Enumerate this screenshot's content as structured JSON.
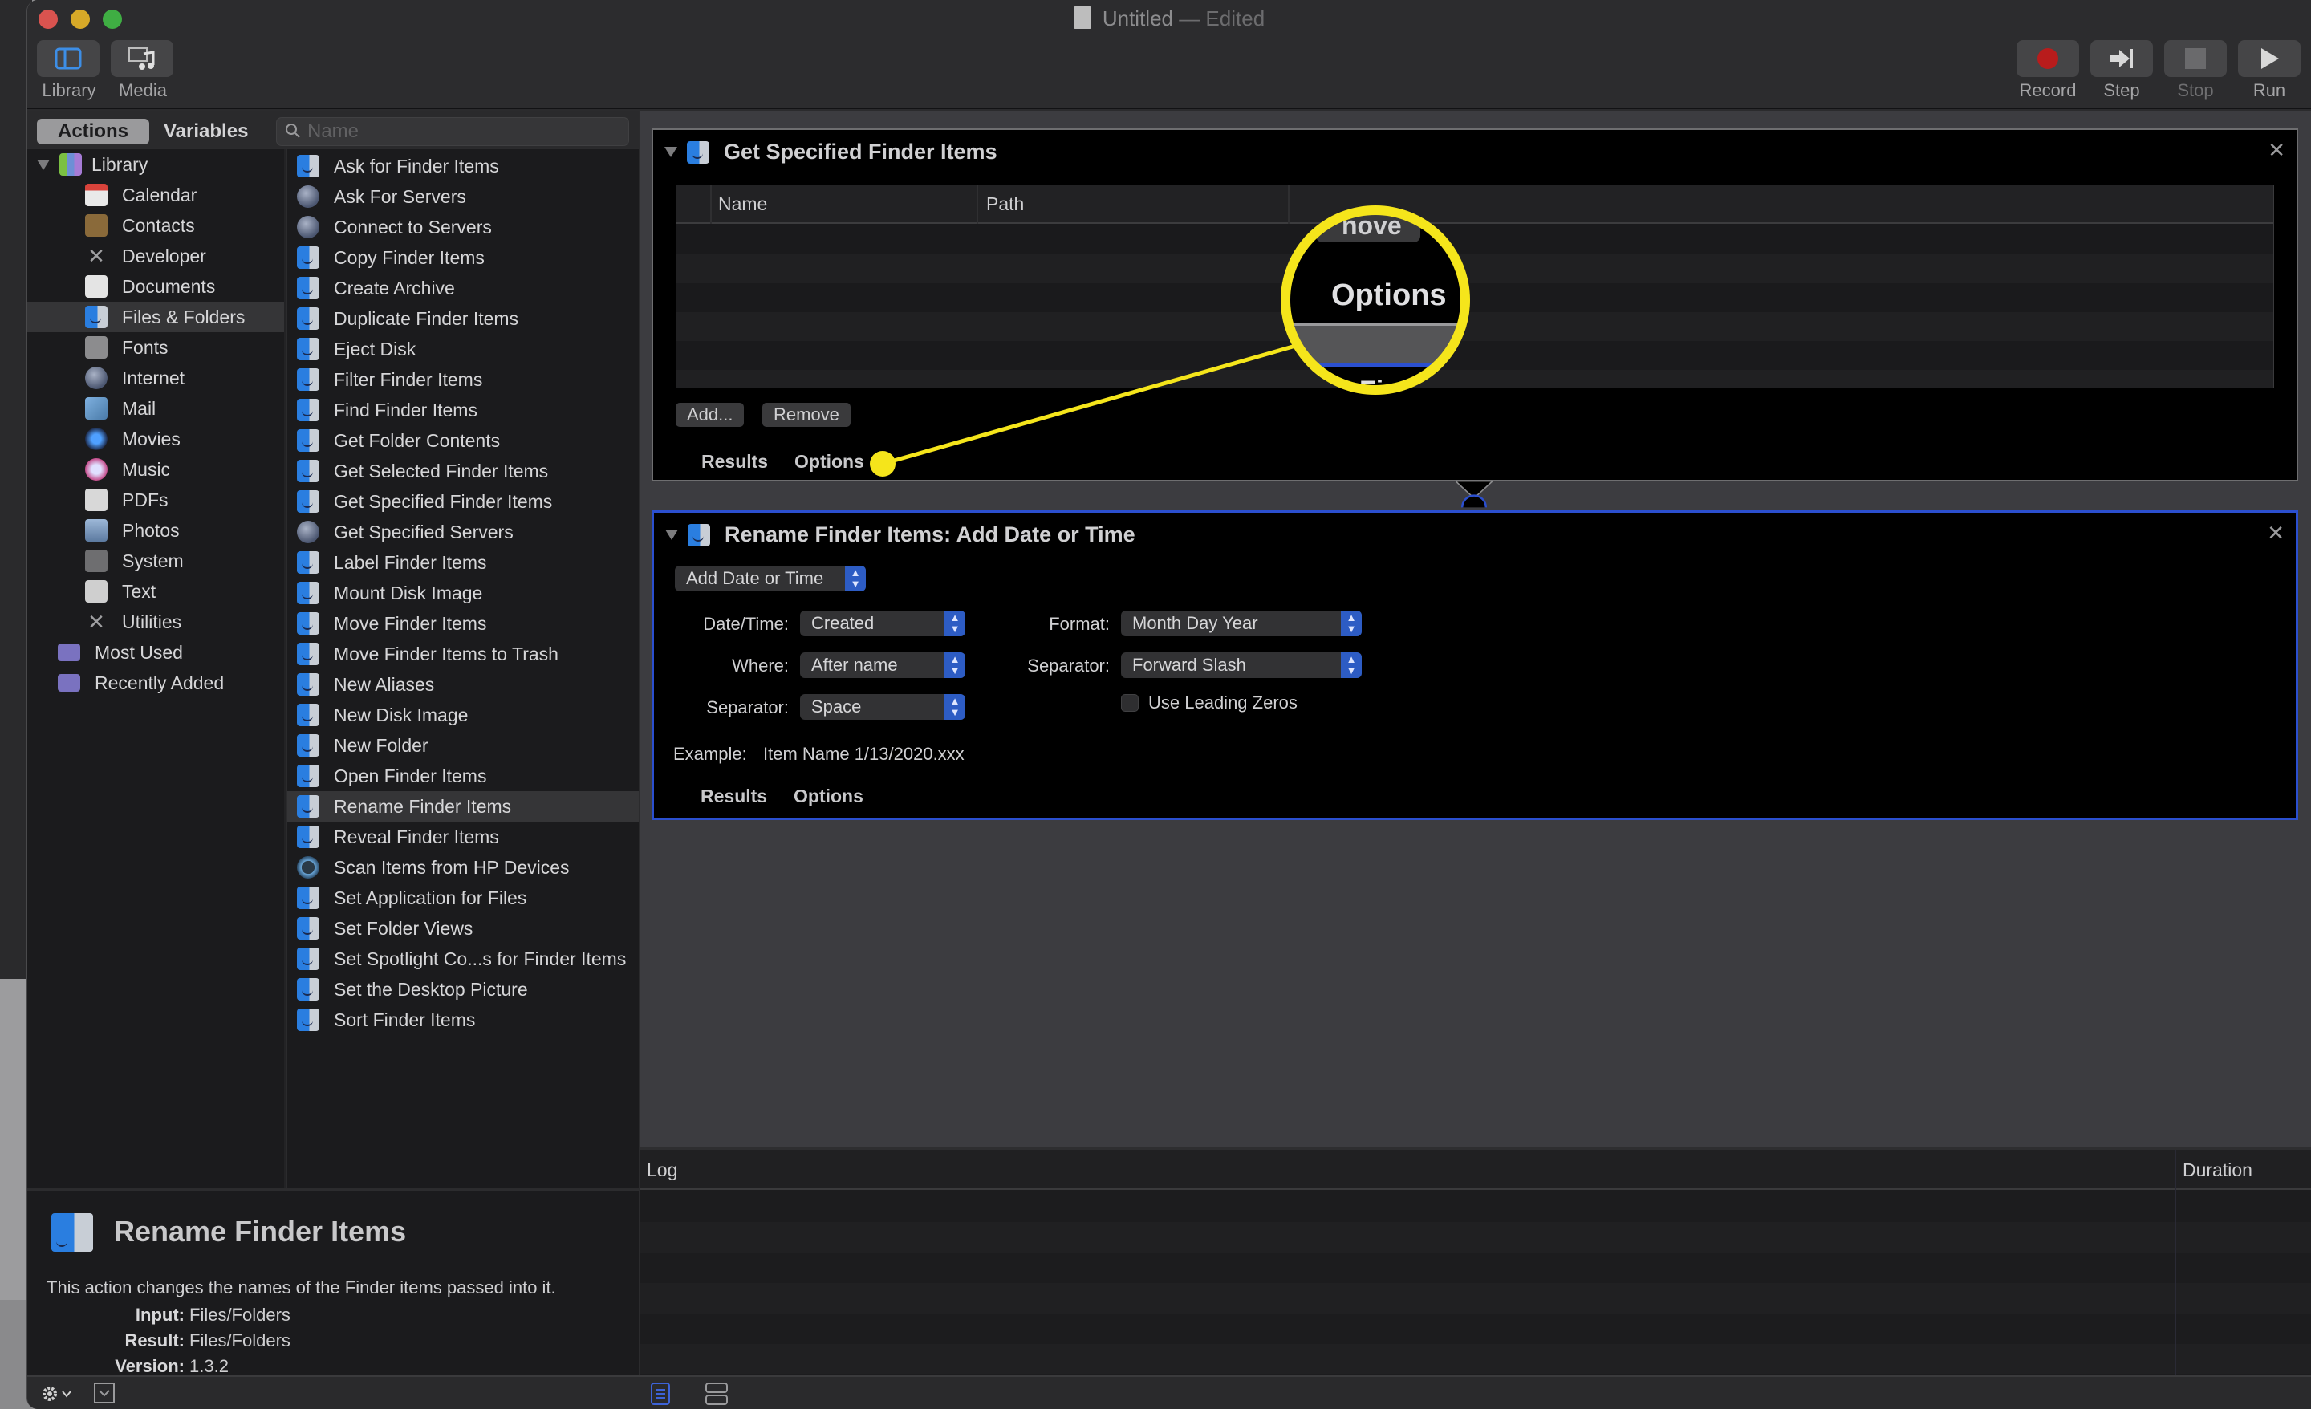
{
  "window": {
    "title": "Untitled",
    "title_suffix": " — Edited"
  },
  "toolbar": {
    "left": [
      {
        "label": "Library",
        "icon": "library-icon"
      },
      {
        "label": "Media",
        "icon": "media-icon"
      }
    ],
    "right": [
      {
        "label": "Record",
        "icon": "record-icon",
        "enabled": true
      },
      {
        "label": "Step",
        "icon": "step-icon",
        "enabled": true
      },
      {
        "label": "Stop",
        "icon": "stop-icon",
        "enabled": false
      },
      {
        "label": "Run",
        "icon": "run-icon",
        "enabled": true
      }
    ]
  },
  "library": {
    "tabs": {
      "actions": "Actions",
      "variables": "Variables"
    },
    "search_placeholder": "Name",
    "root": "Library",
    "categories": [
      {
        "label": "Calendar",
        "icon": "calendar-icon"
      },
      {
        "label": "Contacts",
        "icon": "contacts-icon"
      },
      {
        "label": "Developer",
        "icon": "developer-icon"
      },
      {
        "label": "Documents",
        "icon": "documents-icon"
      },
      {
        "label": "Files & Folders",
        "icon": "finder-icon",
        "selected": true
      },
      {
        "label": "Fonts",
        "icon": "fonts-icon"
      },
      {
        "label": "Internet",
        "icon": "internet-icon"
      },
      {
        "label": "Mail",
        "icon": "mail-icon"
      },
      {
        "label": "Movies",
        "icon": "movies-icon"
      },
      {
        "label": "Music",
        "icon": "music-icon"
      },
      {
        "label": "PDFs",
        "icon": "pdf-icon"
      },
      {
        "label": "Photos",
        "icon": "photos-icon"
      },
      {
        "label": "System",
        "icon": "system-icon"
      },
      {
        "label": "Text",
        "icon": "text-icon"
      },
      {
        "label": "Utilities",
        "icon": "utilities-icon"
      }
    ],
    "smart_groups": [
      {
        "label": "Most Used",
        "icon": "smart-folder-icon"
      },
      {
        "label": "Recently Added",
        "icon": "smart-folder-icon"
      }
    ],
    "actions": [
      {
        "label": "Ask for Finder Items",
        "icon": "finder"
      },
      {
        "label": "Ask For Servers",
        "icon": "globe"
      },
      {
        "label": "Connect to Servers",
        "icon": "globe"
      },
      {
        "label": "Copy Finder Items",
        "icon": "finder"
      },
      {
        "label": "Create Archive",
        "icon": "finder"
      },
      {
        "label": "Duplicate Finder Items",
        "icon": "finder"
      },
      {
        "label": "Eject Disk",
        "icon": "finder"
      },
      {
        "label": "Filter Finder Items",
        "icon": "finder"
      },
      {
        "label": "Find Finder Items",
        "icon": "finder"
      },
      {
        "label": "Get Folder Contents",
        "icon": "finder"
      },
      {
        "label": "Get Selected Finder Items",
        "icon": "finder"
      },
      {
        "label": "Get Specified Finder Items",
        "icon": "finder"
      },
      {
        "label": "Get Specified Servers",
        "icon": "globe"
      },
      {
        "label": "Label Finder Items",
        "icon": "finder"
      },
      {
        "label": "Mount Disk Image",
        "icon": "finder"
      },
      {
        "label": "Move Finder Items",
        "icon": "finder"
      },
      {
        "label": "Move Finder Items to Trash",
        "icon": "finder"
      },
      {
        "label": "New Aliases",
        "icon": "finder"
      },
      {
        "label": "New Disk Image",
        "icon": "finder"
      },
      {
        "label": "New Folder",
        "icon": "finder"
      },
      {
        "label": "Open Finder Items",
        "icon": "finder"
      },
      {
        "label": "Rename Finder Items",
        "icon": "finder",
        "selected": true
      },
      {
        "label": "Reveal Finder Items",
        "icon": "finder"
      },
      {
        "label": "Scan Items from HP Devices",
        "icon": "hp"
      },
      {
        "label": "Set Application for Files",
        "icon": "finder"
      },
      {
        "label": "Set Folder Views",
        "icon": "finder"
      },
      {
        "label": "Set Spotlight Co...s for Finder Items",
        "icon": "finder"
      },
      {
        "label": "Set the Desktop Picture",
        "icon": "finder"
      },
      {
        "label": "Sort Finder Items",
        "icon": "finder"
      }
    ]
  },
  "description": {
    "title": "Rename Finder Items",
    "text": "This action changes the names of the Finder items passed into it.",
    "input_label": "Input:",
    "input_value": "Files/Folders",
    "result_label": "Result:",
    "result_value": "Files/Folders",
    "version_label": "Version:",
    "version_value": "1.3.2"
  },
  "workflow": {
    "action1": {
      "title": "Get Specified Finder Items",
      "columns": [
        "Name",
        "Path"
      ],
      "rows": [],
      "add_button": "Add...",
      "remove_button": "Remove",
      "results_tab": "Results",
      "options_tab": "Options"
    },
    "action2": {
      "title": "Rename Finder Items: Add Date or Time",
      "mode": "Add Date or Time",
      "date_time_label": "Date/Time:",
      "date_time_value": "Created",
      "where_label": "Where:",
      "where_value": "After name",
      "separator_label": "Separator:",
      "separator_value": "Space",
      "format_label": "Format:",
      "format_value": "Month Day Year",
      "format_separator_label": "Separator:",
      "format_separator_value": "Forward Slash",
      "leading_zeros_label": "Use Leading Zeros",
      "leading_zeros_checked": false,
      "example_label": "Example:",
      "example_value": "Item Name 1/13/2020.xxx",
      "results_tab": "Results",
      "options_tab": "Options"
    }
  },
  "callout": {
    "magnified_text": "Options",
    "partial_top_text": "nove",
    "partial_bottom_text": "Fi",
    "color": "#f5e51b"
  },
  "log": {
    "columns": [
      "Log",
      "Duration"
    ],
    "rows": []
  },
  "colors": {
    "accent": "#2b4fcf",
    "record": "#b81c1c",
    "highlight": "#f5e51b"
  }
}
